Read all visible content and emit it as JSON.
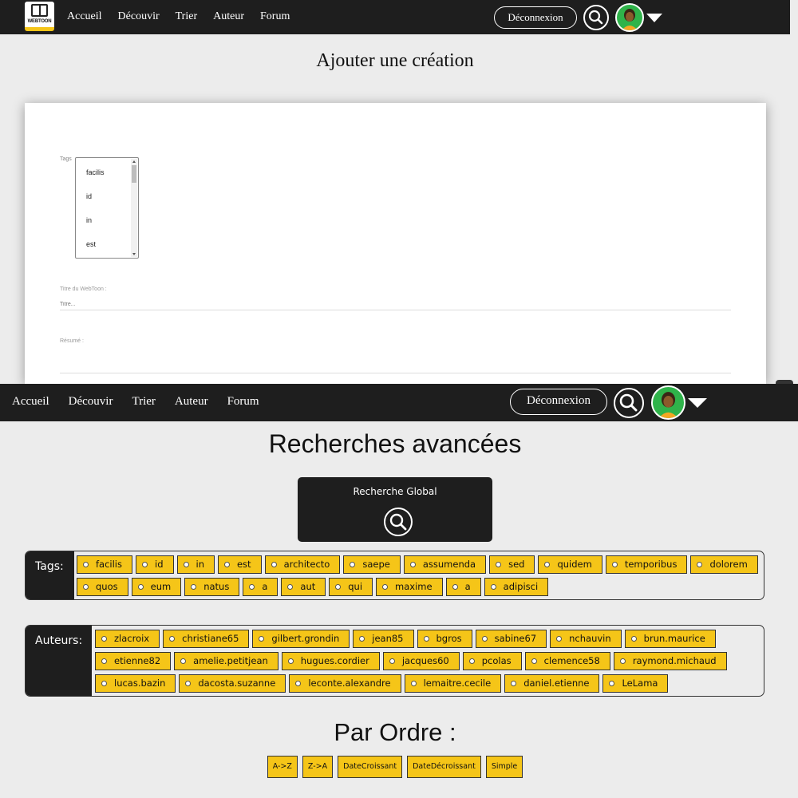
{
  "brand": {
    "logo_text": "WEBTOON"
  },
  "nav": {
    "links": [
      "Accueil",
      "Découvir",
      "Trier",
      "Auteur",
      "Forum"
    ],
    "logout_label": "Déconnexion"
  },
  "form_page": {
    "title": "Ajouter une création",
    "tags_label": "Tags",
    "tag_options": [
      "facilis",
      "id",
      "in",
      "est"
    ],
    "webtoon_title_label": "Titre du WebToon :",
    "webtoon_title_placeholder": "Titre...",
    "summary_label": "Résumé :"
  },
  "search_page": {
    "title": "Recherches avancées",
    "global_label": "Recherche Global",
    "tags_header": "Tags:",
    "tags": [
      "facilis",
      "id",
      "in",
      "est",
      "architecto",
      "saepe",
      "assumenda",
      "sed",
      "quidem",
      "temporibus",
      "dolorem",
      "quos",
      "eum",
      "natus",
      "a",
      "aut",
      "qui",
      "maxime",
      "a",
      "adipisci"
    ],
    "authors_header": "Auteurs:",
    "authors": [
      "zlacroix",
      "christiane65",
      "gilbert.grondin",
      "jean85",
      "bgros",
      "sabine67",
      "nchauvin",
      "brun.maurice",
      "etienne82",
      "amelie.petitjean",
      "hugues.cordier",
      "jacques60",
      "pcolas",
      "clemence58",
      "raymond.michaud",
      "lucas.bazin",
      "dacosta.suzanne",
      "leconte.alexandre",
      "lemaitre.cecile",
      "daniel.etienne",
      "LeLama"
    ],
    "order_title": "Par Ordre :",
    "order_buttons": [
      "A->Z",
      "Z->A",
      "DateCroissant",
      "DateDécroissant",
      "Simple"
    ]
  },
  "colors": {
    "accent": "#f5c518",
    "nav_bg": "#1e1e1e",
    "avatar_bg": "#2fb34a"
  }
}
